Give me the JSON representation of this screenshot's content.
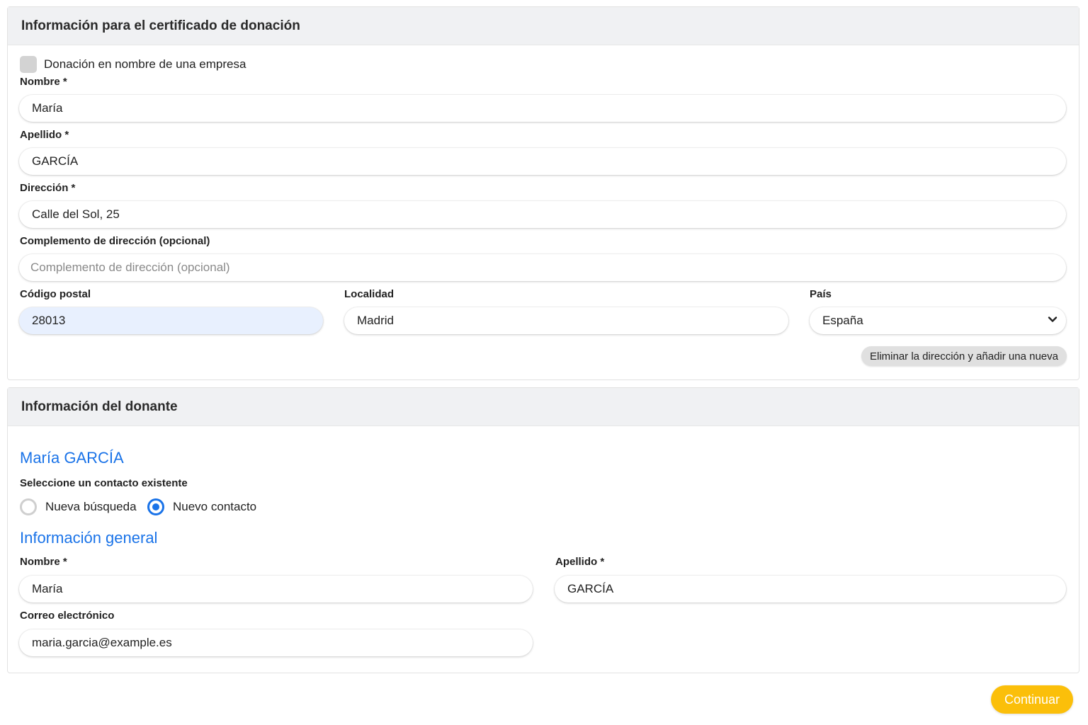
{
  "certificate": {
    "title": "Información para el certificado de donación",
    "company_checkbox_label": "Donación en nombre de una empresa",
    "company_checked": false,
    "first_name_label": "Nombre *",
    "first_name_value": "María",
    "last_name_label": "Apellido *",
    "last_name_value": "GARCÍA",
    "address_label": "Dirección *",
    "address_value": "Calle del Sol, 25",
    "address2_label": "Complemento de dirección (opcional)",
    "address2_placeholder": "Complemento de dirección (opcional)",
    "postal_label": "Código postal",
    "postal_value": "28013",
    "city_label": "Localidad",
    "city_value": "Madrid",
    "country_label": "País",
    "country_value": "España",
    "reset_address_button": "Eliminar la dirección y añadir una nueva"
  },
  "donor": {
    "title": "Información del donante",
    "donor_name": "María GARCÍA",
    "select_contact_label": "Seleccione un contacto existente",
    "radio_options": [
      {
        "label": "Nueva búsqueda",
        "selected": false
      },
      {
        "label": "Nuevo contacto",
        "selected": true
      }
    ],
    "general_info_heading": "Información general",
    "first_name_label": "Nombre *",
    "first_name_value": "María",
    "last_name_label": "Apellido *",
    "last_name_value": "GARCÍA",
    "email_label": "Correo electrónico",
    "email_value": "maria.garcia@example.es"
  },
  "footer": {
    "continue_label": "Continuar"
  },
  "colors": {
    "accent_blue": "#1a73e8",
    "continue_yellow": "#fbbf0a",
    "header_gray": "#f0f1f3"
  }
}
